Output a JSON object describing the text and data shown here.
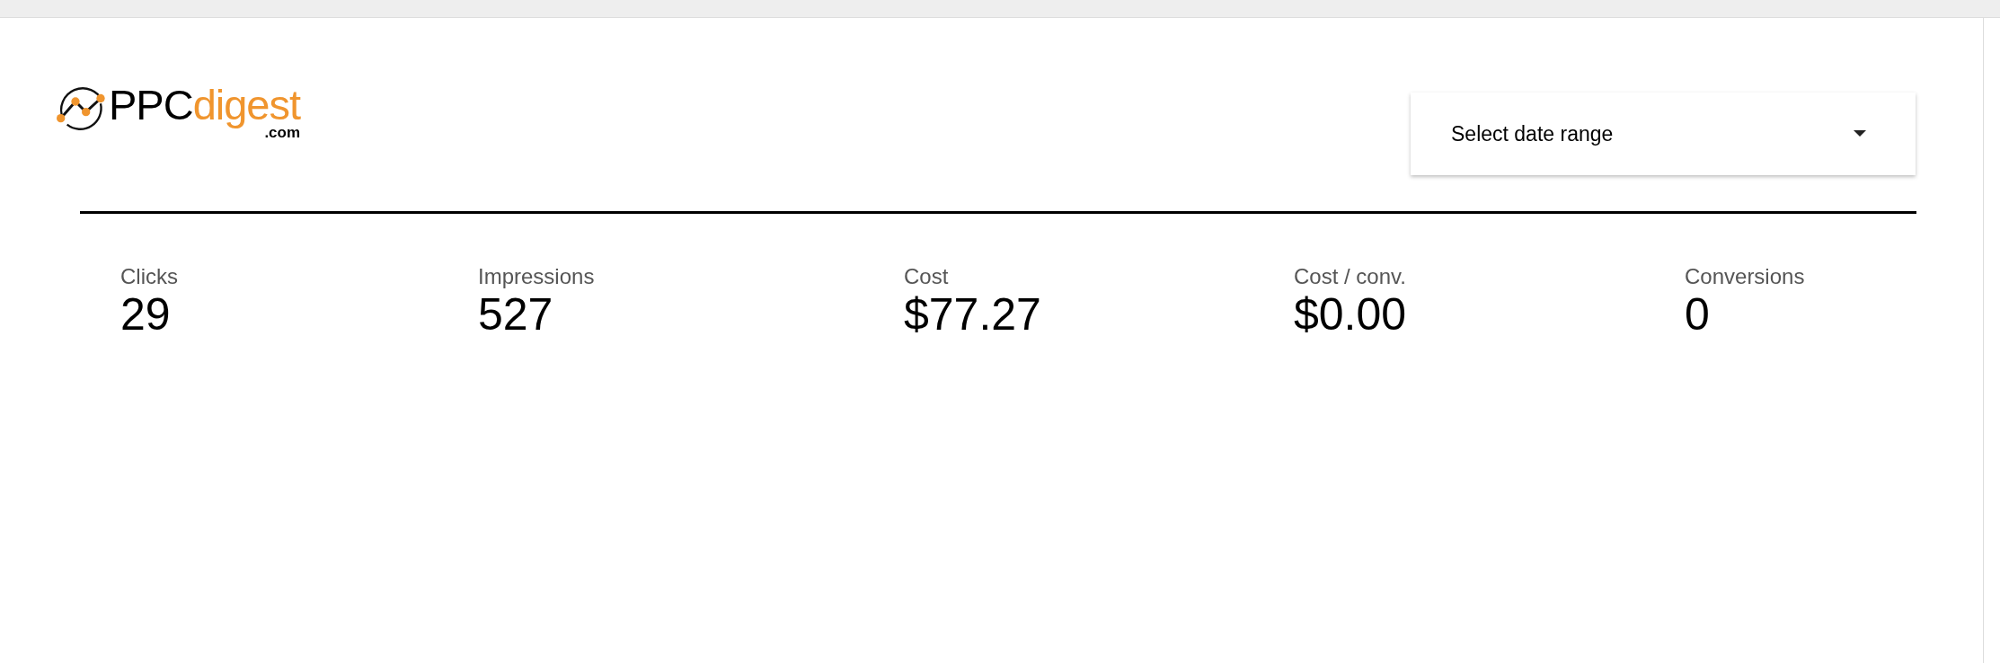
{
  "logo": {
    "brand": "PPC",
    "accent": "digest",
    "suffix": ".com"
  },
  "date_range": {
    "placeholder": "Select date range"
  },
  "metrics": [
    {
      "label": "Clicks",
      "value": "29"
    },
    {
      "label": "Impressions",
      "value": "527"
    },
    {
      "label": "Cost",
      "value": "$77.27"
    },
    {
      "label": "Cost / conv.",
      "value": "$0.00"
    },
    {
      "label": "Conversions",
      "value": "0"
    }
  ]
}
